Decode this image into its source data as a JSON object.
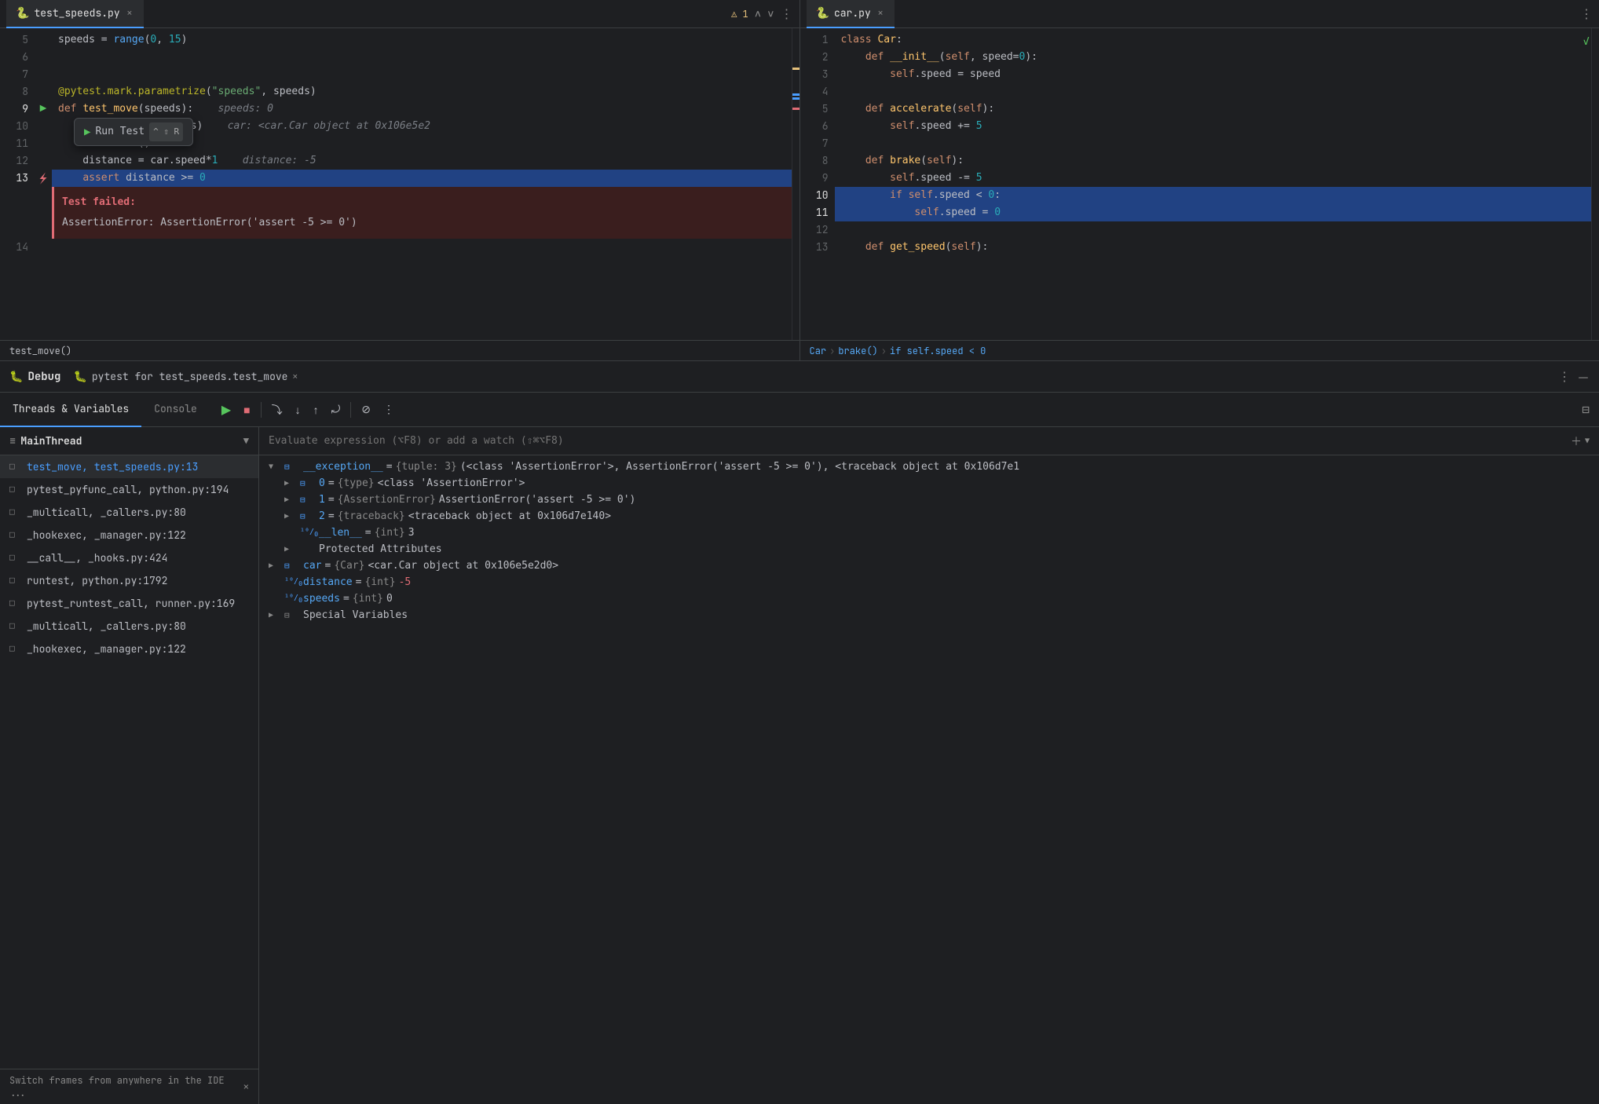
{
  "left_editor": {
    "tab_label": "test_speeds.py",
    "tab_active": true,
    "lines": [
      {
        "num": 5,
        "content": "speeds = range(0, 15)",
        "tokens": [
          {
            "text": "speeds",
            "cls": "var"
          },
          {
            "text": " = ",
            "cls": "op"
          },
          {
            "text": "range",
            "cls": "fn"
          },
          {
            "text": "(",
            "cls": "op"
          },
          {
            "text": "0",
            "cls": "num"
          },
          {
            "text": ", ",
            "cls": "op"
          },
          {
            "text": "15",
            "cls": "num"
          },
          {
            "text": ")",
            "cls": "op"
          }
        ]
      },
      {
        "num": 6,
        "content": ""
      },
      {
        "num": 7,
        "content": ""
      },
      {
        "num": 8,
        "content": "@pytest.mark.parametrize(\"speeds\", speeds)",
        "tokens": [
          {
            "text": "@pytest.mark.parametrize",
            "cls": "decorator"
          },
          {
            "text": "(",
            "cls": "op"
          },
          {
            "text": "\"speeds\"",
            "cls": "string"
          },
          {
            "text": ", speeds)",
            "cls": "op"
          }
        ]
      },
      {
        "num": 9,
        "content": "def test_move(speeds):    speeds: 0",
        "tokens": [
          {
            "text": "def ",
            "cls": "kw"
          },
          {
            "text": "test_move",
            "cls": "fn2"
          },
          {
            "text": "(speeds):",
            "cls": "op"
          },
          {
            "text": "    speeds: 0",
            "cls": "inline-val"
          }
        ]
      },
      {
        "num": 10,
        "content": "    car = Car(speeds)    car: <car.Car object at 0x106e5e2",
        "tokens": [
          {
            "text": "    car = ",
            "cls": "op"
          },
          {
            "text": "Car",
            "cls": "fn2"
          },
          {
            "text": "(speeds)",
            "cls": "op"
          },
          {
            "text": "    car: <car.Car object at 0x106e5e2",
            "cls": "inline-val"
          }
        ]
      },
      {
        "num": 11,
        "content": "    car.brake()",
        "tokens": [
          {
            "text": "    car.",
            "cls": "op"
          },
          {
            "text": "brake",
            "cls": "fn2"
          },
          {
            "text": "()",
            "cls": "op"
          }
        ]
      },
      {
        "num": 12,
        "content": "    distance = car.speed*1    distance: -5",
        "tokens": [
          {
            "text": "    distance = car.speed*",
            "cls": "op"
          },
          {
            "text": "1",
            "cls": "num"
          },
          {
            "text": "    distance: -5",
            "cls": "inline-val"
          }
        ]
      },
      {
        "num": 13,
        "content": "    assert distance >= 0",
        "highlighted": true,
        "tokens": [
          {
            "text": "    ",
            "cls": "op"
          },
          {
            "text": "assert",
            "cls": "kw"
          },
          {
            "text": " distance >= ",
            "cls": "op"
          },
          {
            "text": "0",
            "cls": "num"
          }
        ]
      },
      {
        "num": 14,
        "content": ""
      }
    ],
    "error": {
      "title": "Test failed:",
      "message": "AssertionError: AssertionError('assert -5 >= 0')"
    },
    "breadcrumb": "test_move()"
  },
  "right_editor": {
    "tab_label": "car.py",
    "tab_active": true,
    "lines": [
      {
        "num": 1,
        "content": "class Car:",
        "tokens": [
          {
            "text": "class ",
            "cls": "kw"
          },
          {
            "text": "Car",
            "cls": "fn2"
          },
          {
            "text": ":",
            "cls": "op"
          }
        ]
      },
      {
        "num": 2,
        "content": "    def __init__(self, speed=0):",
        "tokens": [
          {
            "text": "    ",
            "cls": "op"
          },
          {
            "text": "def ",
            "cls": "kw"
          },
          {
            "text": "__init__",
            "cls": "fn2"
          },
          {
            "text": "(",
            "cls": "op"
          },
          {
            "text": "self",
            "cls": "self-kw"
          },
          {
            "text": ", speed=",
            "cls": "op"
          },
          {
            "text": "0",
            "cls": "num"
          },
          {
            "text": "):",
            "cls": "op"
          }
        ]
      },
      {
        "num": 3,
        "content": "        self.speed = speed",
        "tokens": [
          {
            "text": "        ",
            "cls": "op"
          },
          {
            "text": "self",
            "cls": "self-kw"
          },
          {
            "text": ".speed = speed",
            "cls": "op"
          }
        ]
      },
      {
        "num": 4,
        "content": ""
      },
      {
        "num": 5,
        "content": "    def accelerate(self):",
        "tokens": [
          {
            "text": "    ",
            "cls": "op"
          },
          {
            "text": "def ",
            "cls": "kw"
          },
          {
            "text": "accelerate",
            "cls": "fn2"
          },
          {
            "text": "(",
            "cls": "op"
          },
          {
            "text": "self",
            "cls": "self-kw"
          },
          {
            "text": "):",
            "cls": "op"
          }
        ]
      },
      {
        "num": 6,
        "content": "        self.speed += 5",
        "tokens": [
          {
            "text": "        ",
            "cls": "op"
          },
          {
            "text": "self",
            "cls": "self-kw"
          },
          {
            "text": ".speed += ",
            "cls": "op"
          },
          {
            "text": "5",
            "cls": "num"
          }
        ]
      },
      {
        "num": 7,
        "content": ""
      },
      {
        "num": 8,
        "content": "    def brake(self):",
        "tokens": [
          {
            "text": "    ",
            "cls": "op"
          },
          {
            "text": "def ",
            "cls": "kw"
          },
          {
            "text": "brake",
            "cls": "fn2"
          },
          {
            "text": "(",
            "cls": "op"
          },
          {
            "text": "self",
            "cls": "self-kw"
          },
          {
            "text": "):",
            "cls": "op"
          }
        ]
      },
      {
        "num": 9,
        "content": "        self.speed -= 5",
        "tokens": [
          {
            "text": "        ",
            "cls": "op"
          },
          {
            "text": "self",
            "cls": "self-kw"
          },
          {
            "text": ".speed -= ",
            "cls": "op"
          },
          {
            "text": "5",
            "cls": "num"
          }
        ]
      },
      {
        "num": 10,
        "content": "        if self.speed < 0:",
        "highlighted": true,
        "tokens": [
          {
            "text": "        ",
            "cls": "op"
          },
          {
            "text": "if ",
            "cls": "kw"
          },
          {
            "text": "self",
            "cls": "self-kw"
          },
          {
            "text": ".speed < ",
            "cls": "op"
          },
          {
            "text": "0",
            "cls": "num"
          },
          {
            "text": ":",
            "cls": "op"
          }
        ]
      },
      {
        "num": 11,
        "content": "            self.speed = 0",
        "highlighted": true,
        "tokens": [
          {
            "text": "            ",
            "cls": "op"
          },
          {
            "text": "self",
            "cls": "self-kw"
          },
          {
            "text": ".speed = ",
            "cls": "op"
          },
          {
            "text": "0",
            "cls": "num"
          }
        ]
      },
      {
        "num": 12,
        "content": ""
      },
      {
        "num": 13,
        "content": "    def get_speed(self):",
        "tokens": [
          {
            "text": "    ",
            "cls": "op"
          },
          {
            "text": "def ",
            "cls": "kw"
          },
          {
            "text": "get_speed",
            "cls": "fn2"
          },
          {
            "text": "(",
            "cls": "op"
          },
          {
            "text": "self",
            "cls": "self-kw"
          },
          {
            "text": "):",
            "cls": "op"
          }
        ]
      }
    ],
    "breadcrumb_parts": [
      "Car",
      "brake()",
      "if self.speed < 0"
    ]
  },
  "debug": {
    "tab_label": "Debug",
    "session_icon": "🐛",
    "session_label": "pytest for test_speeds.test_move",
    "tabs": [
      "Threads & Variables",
      "Console"
    ],
    "active_tab": "Threads & Variables",
    "toolbar_buttons": [
      "resume",
      "stop",
      "step-over",
      "step-into",
      "step-out",
      "run-to-cursor",
      "mute-breakpoints",
      "more"
    ],
    "thread": {
      "name": "MainThread",
      "frames": [
        "test_move, test_speeds.py:13",
        "pytest_pyfunc_call, python.py:194",
        "_multicall, _callers.py:80",
        "_hookexec, _manager.py:122",
        "__call__, _hooks.py:424",
        "runtest, python.py:1792",
        "pytest_runtest_call, runner.py:169",
        "_multicall, _callers.py:80",
        "_hookexec, _manager.py:122"
      ]
    },
    "variables": [
      {
        "expanded": true,
        "indent": 0,
        "icon": "tuple",
        "name": "__exception__",
        "eq": " = ",
        "type": "{tuple: 3}",
        "value": " (<class 'AssertionError'>, AssertionError('assert -5 >= 0'), <traceback object at 0x106d7e1"
      },
      {
        "expanded": false,
        "indent": 1,
        "icon": "obj",
        "name": "0",
        "eq": " = ",
        "type": "{type}",
        "value": " <class 'AssertionError'>"
      },
      {
        "expanded": false,
        "indent": 1,
        "icon": "obj",
        "name": "1",
        "eq": " = ",
        "type": "{AssertionError}",
        "value": " AssertionError('assert -5 >= 0')"
      },
      {
        "expanded": false,
        "indent": 1,
        "icon": "obj",
        "name": "2",
        "eq": " = ",
        "type": "{traceback}",
        "value": " <traceback object at 0x106d7e140>"
      },
      {
        "expanded": false,
        "indent": 1,
        "icon": "int",
        "name": "__len__",
        "eq": " = ",
        "type": "{int}",
        "value": " 3"
      },
      {
        "expanded": false,
        "indent": 1,
        "icon": null,
        "name": "Protected Attributes",
        "eq": "",
        "type": "",
        "value": ""
      },
      {
        "expanded": false,
        "indent": 0,
        "icon": "obj",
        "name": "car",
        "eq": " = ",
        "type": "{Car}",
        "value": " <car.Car object at 0x106e5e2d0>"
      },
      {
        "expanded": false,
        "indent": 0,
        "icon": "int",
        "name": "distance",
        "eq": " = ",
        "type": "{int}",
        "value": " -5",
        "negative": true
      },
      {
        "expanded": false,
        "indent": 0,
        "icon": "int",
        "name": "speeds",
        "eq": " = ",
        "type": "{int}",
        "value": " 0"
      },
      {
        "expanded": false,
        "indent": 0,
        "icon": null,
        "name": "Special Variables",
        "eq": "",
        "type": "",
        "value": ""
      }
    ],
    "expr_placeholder": "Evaluate expression (⌥F8) or add a watch (⇧⌘⌥F8)",
    "switch_frames": "Switch frames from anywhere in the IDE ..."
  },
  "run_test_popup": {
    "label": "Run Test",
    "shortcut": "^ ⇧ R"
  }
}
